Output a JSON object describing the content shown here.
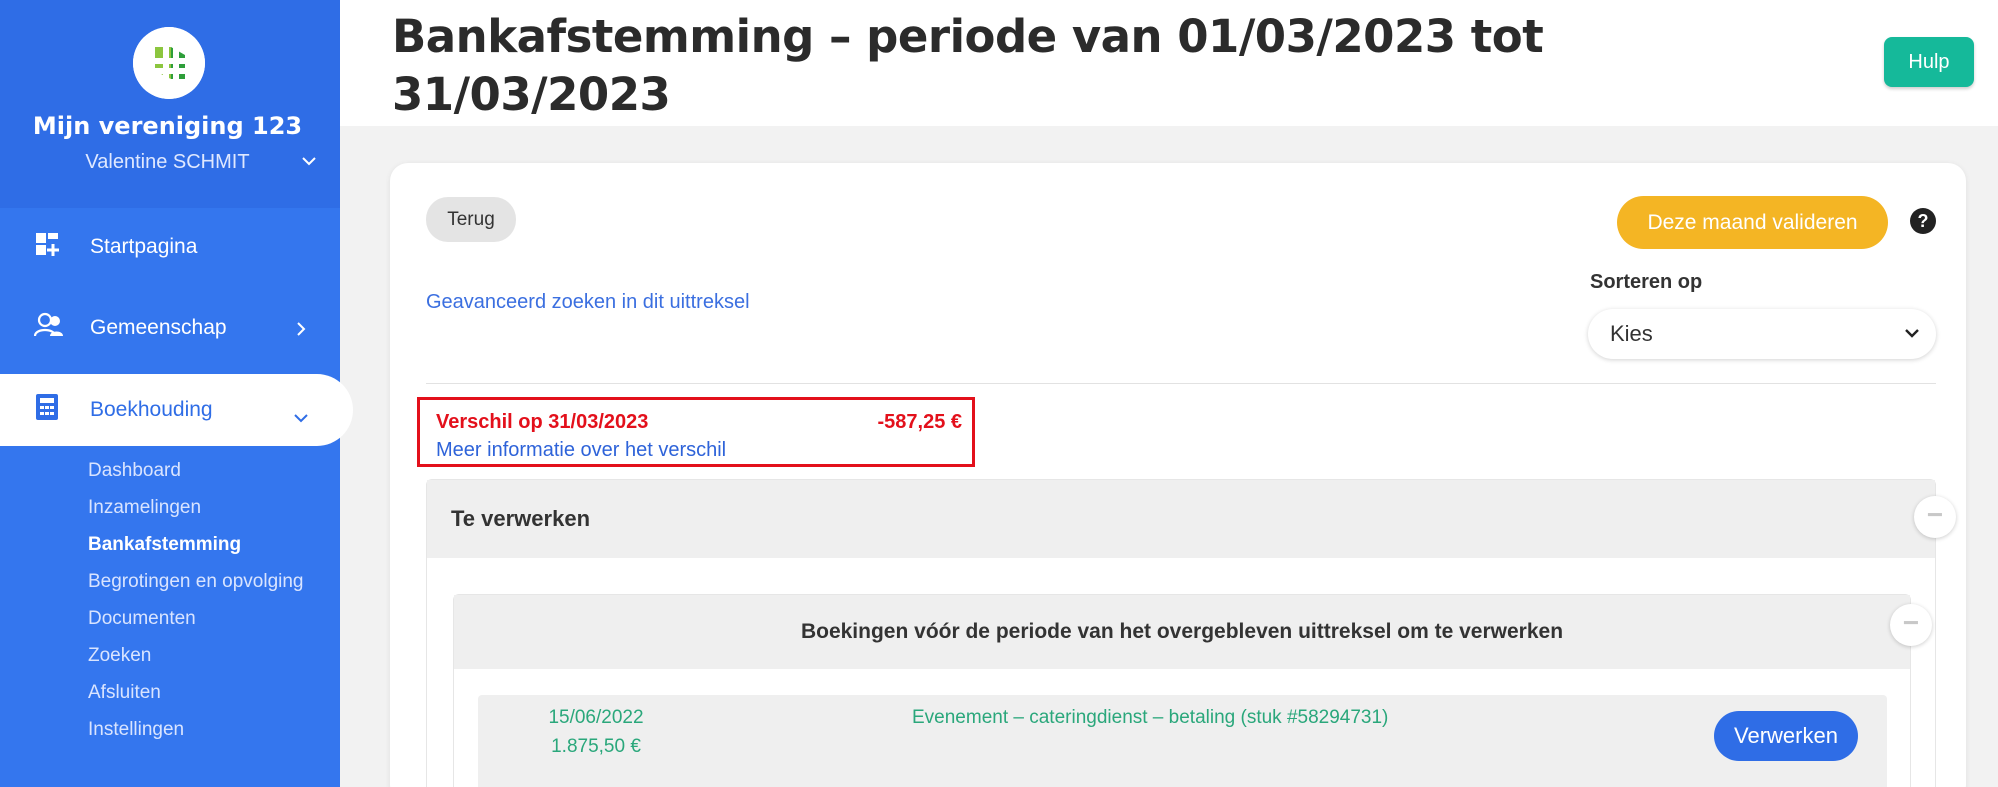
{
  "sidebar": {
    "org_name": "Mijn vereniging 123",
    "user_name": "Valentine SCHMIT",
    "nav": [
      {
        "label": "Startpagina",
        "icon": "dashboard-icon"
      },
      {
        "label": "Gemeenschap",
        "icon": "users-icon"
      },
      {
        "label": "Boekhouding",
        "icon": "calculator-icon"
      }
    ],
    "sub_items": [
      "Dashboard",
      "Inzamelingen",
      "Bankafstemming",
      "Begrotingen en opvolging",
      "Documenten",
      "Zoeken",
      "Afsluiten",
      "Instellingen"
    ],
    "active_sub": "Bankafstemming"
  },
  "header": {
    "title": "Bankafstemming – periode van 01/03/2023 tot 31/03/2023",
    "help_label": "Hulp"
  },
  "toolbar": {
    "back_label": "Terug",
    "validate_label": "Deze maand valideren",
    "help_icon_text": "?",
    "advanced_search_label": "Geavanceerd zoeken in dit uittreksel",
    "sort_label": "Sorteren op",
    "sort_value": "Kies"
  },
  "difference": {
    "label": "Verschil op 31/03/2023",
    "value": "-587,25 €",
    "link": "Meer informatie over het verschil"
  },
  "sections": {
    "to_process_title": "Te verwerken",
    "entries_title": "Boekingen vóór de periode van het overgebleven uittreksel om te verwerken",
    "collapse_symbol": "−"
  },
  "entries": [
    {
      "date": "15/06/2022",
      "amount": "1.875,50 €",
      "description": "Evenement – cateringdienst – betaling (stuk #58294731)",
      "action": "Verwerken"
    }
  ],
  "colors": {
    "sidebar": "#3476ee",
    "help_button": "#15b99a",
    "validate_button": "#f4b524",
    "difference": "#e3101b",
    "entry_text": "#2aa77b",
    "primary_button": "#2f6de6"
  }
}
